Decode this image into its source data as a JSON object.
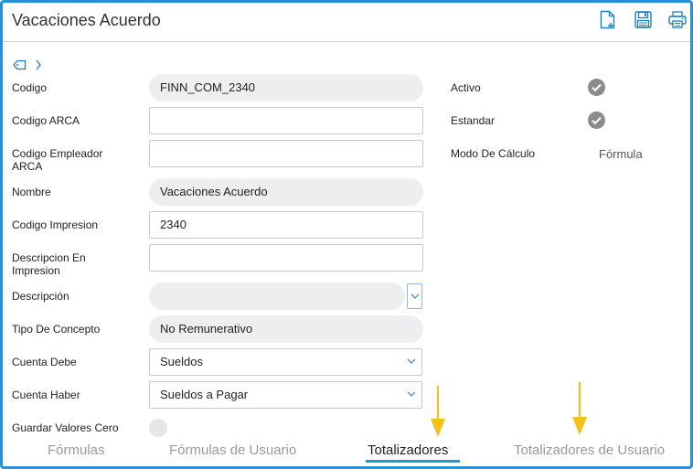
{
  "header": {
    "title": "Vacaciones Acuerdo",
    "icons": [
      "new-document-icon",
      "save-icon",
      "print-icon"
    ]
  },
  "breadcrumb": {
    "icons": [
      "tag-icon",
      "chevron-right-icon"
    ]
  },
  "form": {
    "codigo": {
      "label": "Codigo",
      "value": "FINN_COM_2340"
    },
    "codigo_arca": {
      "label": "Codigo ARCA",
      "value": ""
    },
    "codigo_empleador_arca": {
      "label": "Codigo Empleador ARCA",
      "value": ""
    },
    "nombre": {
      "label": "Nombre",
      "value": "Vacaciones Acuerdo"
    },
    "codigo_impresion": {
      "label": "Codigo Impresion",
      "value": "2340"
    },
    "descripcion_impresion": {
      "label": "Descripcion En Impresion",
      "value": ""
    },
    "descripcion": {
      "label": "Descripción",
      "value": ""
    },
    "tipo_concepto": {
      "label": "Tipo De Concepto",
      "value": "No Remunerativo"
    },
    "cuenta_debe": {
      "label": "Cuenta Debe",
      "value": "Sueldos"
    },
    "cuenta_haber": {
      "label": "Cuenta Haber",
      "value": "Sueldos a Pagar"
    },
    "guardar_valores_cero": {
      "label": "Guardar Valores Cero"
    }
  },
  "side": {
    "activo": {
      "label": "Activo",
      "checked": true
    },
    "estandar": {
      "label": "Estandar",
      "checked": true
    },
    "modo_calculo": {
      "label": "Modo De Cálculo",
      "value": "Fórmula"
    }
  },
  "tabs": [
    {
      "label": "Fórmulas",
      "active": false
    },
    {
      "label": "Fórmulas de Usuario",
      "active": false
    },
    {
      "label": "Totalizadores",
      "active": true
    },
    {
      "label": "Totalizadores de Usuario",
      "active": false
    }
  ],
  "colors": {
    "accent": "#1a9bd7",
    "frame": "#2b8fd6",
    "arrow": "#f5c018"
  }
}
